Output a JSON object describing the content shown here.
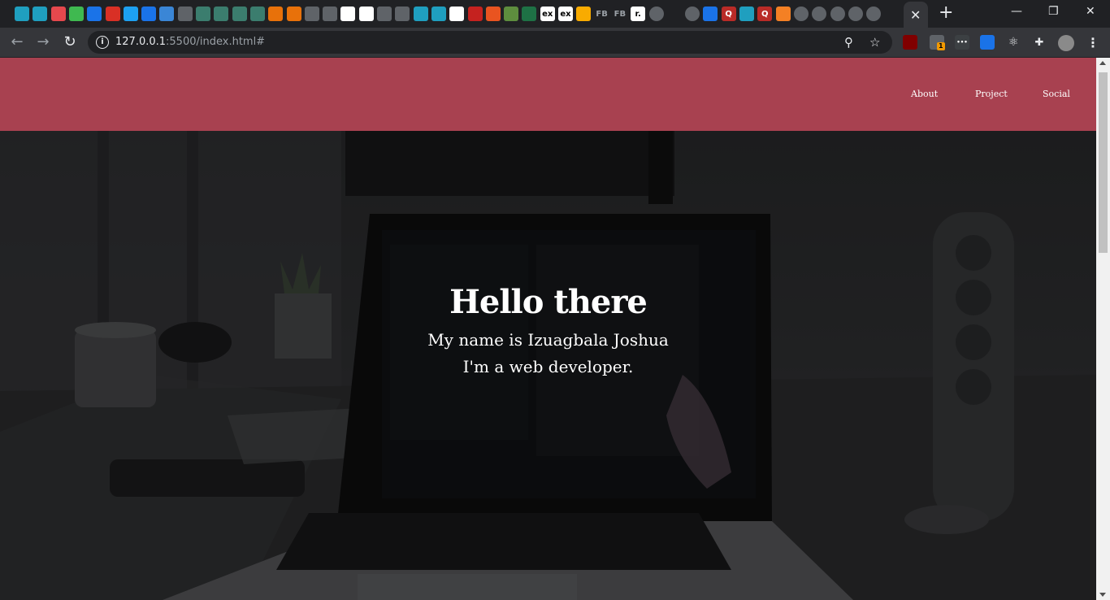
{
  "browser": {
    "address": {
      "host": "127.0.0.1",
      "rest": ":5500/index.html#"
    },
    "new_tab_symbol": "+",
    "close_tab_symbol": "✕",
    "minimize_symbol": "—",
    "restore_symbol": "❐",
    "close_window_symbol": "✕",
    "tab_favicons": [
      "react-icon",
      "react-icon",
      "m-icon",
      "v-icon",
      "s-icon",
      "gmail-icon",
      "twitter-icon",
      "flag-icon",
      "f-icon",
      "wifi-icon",
      "image-icon",
      "image-icon",
      "image-icon",
      "image-icon",
      "fire-icon",
      "fire-icon",
      "a-icon",
      "dash-icon",
      "google-icon",
      "codepen-icon",
      "wordpress-icon",
      "a-icon",
      "react-icon",
      "react-icon",
      "codepen-icon",
      "u-icon",
      "ubuntu-icon",
      "shopify-icon",
      "excel-icon",
      "ex-icon",
      "ex-icon",
      "pencil-icon",
      "fb-icon",
      "fb-icon",
      "r-icon",
      "globe-icon",
      "netflix-icon",
      "globe-icon",
      "flag-icon",
      "q-icon",
      "react-icon",
      "q-icon",
      "stack-icon",
      "globe-icon",
      "globe-icon",
      "globe-icon",
      "globe-icon",
      "globe-icon"
    ],
    "tab_favicon_labels": {
      "ex": "ex",
      "fb": "FB",
      "q": "Q",
      "r": "r."
    },
    "extensions": [
      "ublock-icon",
      "extension-badge-icon",
      "dots-icon",
      "s-icon",
      "react-icon",
      "puzzle-icon",
      "avatar"
    ],
    "extension_badge": "1"
  },
  "site": {
    "nav": [
      "About",
      "Project",
      "Social"
    ],
    "hero": {
      "title": "Hello there",
      "line1": "My name is Izuagbala Joshua",
      "line2": "I'm a web developer."
    }
  },
  "colors": {
    "header_bg": "#a84150",
    "chrome_dark": "#202124",
    "toolbar": "#35363a"
  }
}
